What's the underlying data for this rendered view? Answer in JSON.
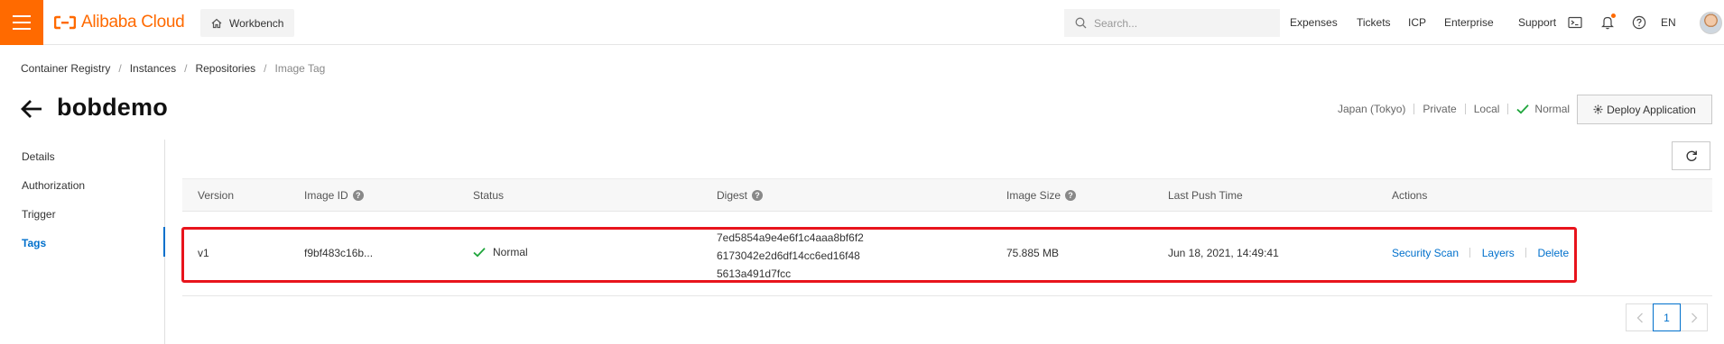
{
  "topbar": {
    "menu_icon": "hamburger-icon",
    "logo_text": "Alibaba Cloud",
    "workbench_label": "Workbench",
    "search_placeholder": "Search...",
    "nav": [
      "Expenses",
      "Tickets",
      "ICP",
      "Enterprise",
      "Support"
    ],
    "language": "EN",
    "brand_color": "#ff6a00"
  },
  "breadcrumb": [
    "Container Registry",
    "Instances",
    "Repositories",
    "Image Tag"
  ],
  "page": {
    "title": "bobdemo",
    "region": "Japan (Tokyo)",
    "visibility": "Private",
    "source": "Local",
    "status": "Normal",
    "deploy_label": "Deploy Application"
  },
  "sidenav": {
    "items": [
      "Details",
      "Authorization",
      "Trigger",
      "Tags"
    ],
    "active": "Tags",
    "active_color": "#0070cc"
  },
  "table": {
    "headers": {
      "version": "Version",
      "image_id": "Image ID",
      "status": "Status",
      "digest": "Digest",
      "image_size": "Image Size",
      "last_push": "Last Push Time",
      "actions": "Actions"
    },
    "rows": [
      {
        "version": "v1",
        "image_id": "f9bf483c16b...",
        "status": "Normal",
        "digest_lines": [
          "7ed5854a9e4e6f1c4aaa8bf6f2",
          "6173042e2d6df14cc6ed16f48",
          "5613a491d7fcc"
        ],
        "image_size": "75.885 MB",
        "last_push": "Jun 18, 2021, 14:49:41",
        "actions": [
          "Security Scan",
          "Layers",
          "Delete"
        ]
      }
    ]
  },
  "pagination": {
    "current_page": "1"
  },
  "highlight_color": "#e8141c",
  "status_color": "#1ea53b"
}
